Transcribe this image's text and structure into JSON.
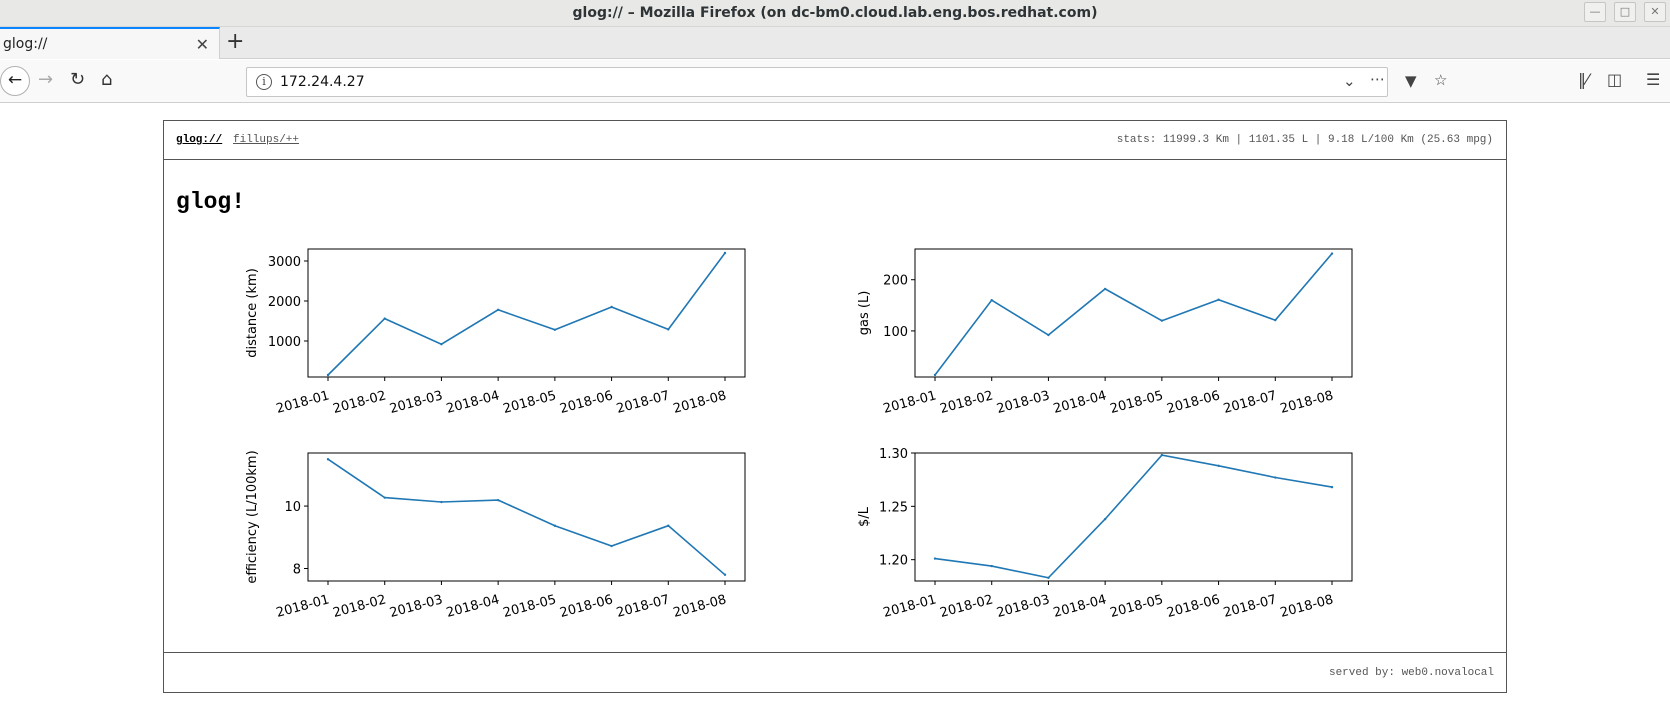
{
  "window": {
    "title": "glog:// – Mozilla Firefox (on dc-bm0.cloud.lab.eng.bos.redhat.com)"
  },
  "tabs": [
    {
      "label": "glog://",
      "active": true
    }
  ],
  "navbar": {
    "url": "172.24.4.27"
  },
  "page": {
    "brand": "glog://",
    "nav_link": "fillups/++",
    "stats": "stats: 11999.3 Km | 1101.35 L | 9.18 L/100 Km (25.63 mpg)",
    "heading": "glog!",
    "footer": "served by: web0.novalocal"
  },
  "colors": {
    "line": "#1f77b4",
    "tab_accent": "#0a84ff"
  },
  "chart_data": [
    {
      "type": "line",
      "ylabel": "distance (km)",
      "x": [
        "2018-01",
        "2018-02",
        "2018-03",
        "2018-04",
        "2018-05",
        "2018-06",
        "2018-07",
        "2018-08"
      ],
      "values": [
        150,
        1560,
        920,
        1780,
        1280,
        1850,
        1290,
        3200
      ],
      "ylim": [
        100,
        3300
      ],
      "yticks": [
        1000,
        2000,
        3000
      ],
      "ytick_labels": [
        "1000",
        "2000",
        "3000"
      ]
    },
    {
      "type": "line",
      "ylabel": "gas (L)",
      "x": [
        "2018-01",
        "2018-02",
        "2018-03",
        "2018-04",
        "2018-05",
        "2018-06",
        "2018-07",
        "2018-08"
      ],
      "values": [
        14,
        160,
        92,
        182,
        120,
        161,
        121,
        251
      ],
      "ylim": [
        10,
        260
      ],
      "yticks": [
        100,
        200
      ],
      "ytick_labels": [
        "100",
        "200"
      ]
    },
    {
      "type": "line",
      "ylabel": "efficiency (L/100km)",
      "x": [
        "2018-01",
        "2018-02",
        "2018-03",
        "2018-04",
        "2018-05",
        "2018-06",
        "2018-07",
        "2018-08"
      ],
      "values": [
        11.5,
        10.27,
        10.13,
        10.19,
        9.37,
        8.72,
        9.37,
        7.8
      ],
      "ylim": [
        7.6,
        11.7
      ],
      "yticks": [
        8,
        10
      ],
      "ytick_labels": [
        "8",
        "10"
      ]
    },
    {
      "type": "line",
      "ylabel": "$/L",
      "x": [
        "2018-01",
        "2018-02",
        "2018-03",
        "2018-04",
        "2018-05",
        "2018-06",
        "2018-07",
        "2018-08"
      ],
      "values": [
        1.201,
        1.194,
        1.183,
        1.238,
        1.298,
        1.288,
        1.277,
        1.268
      ],
      "ylim": [
        1.18,
        1.3
      ],
      "yticks": [
        1.2,
        1.25,
        1.3
      ],
      "ytick_labels": [
        "1.20",
        "1.25",
        "1.30"
      ]
    }
  ]
}
